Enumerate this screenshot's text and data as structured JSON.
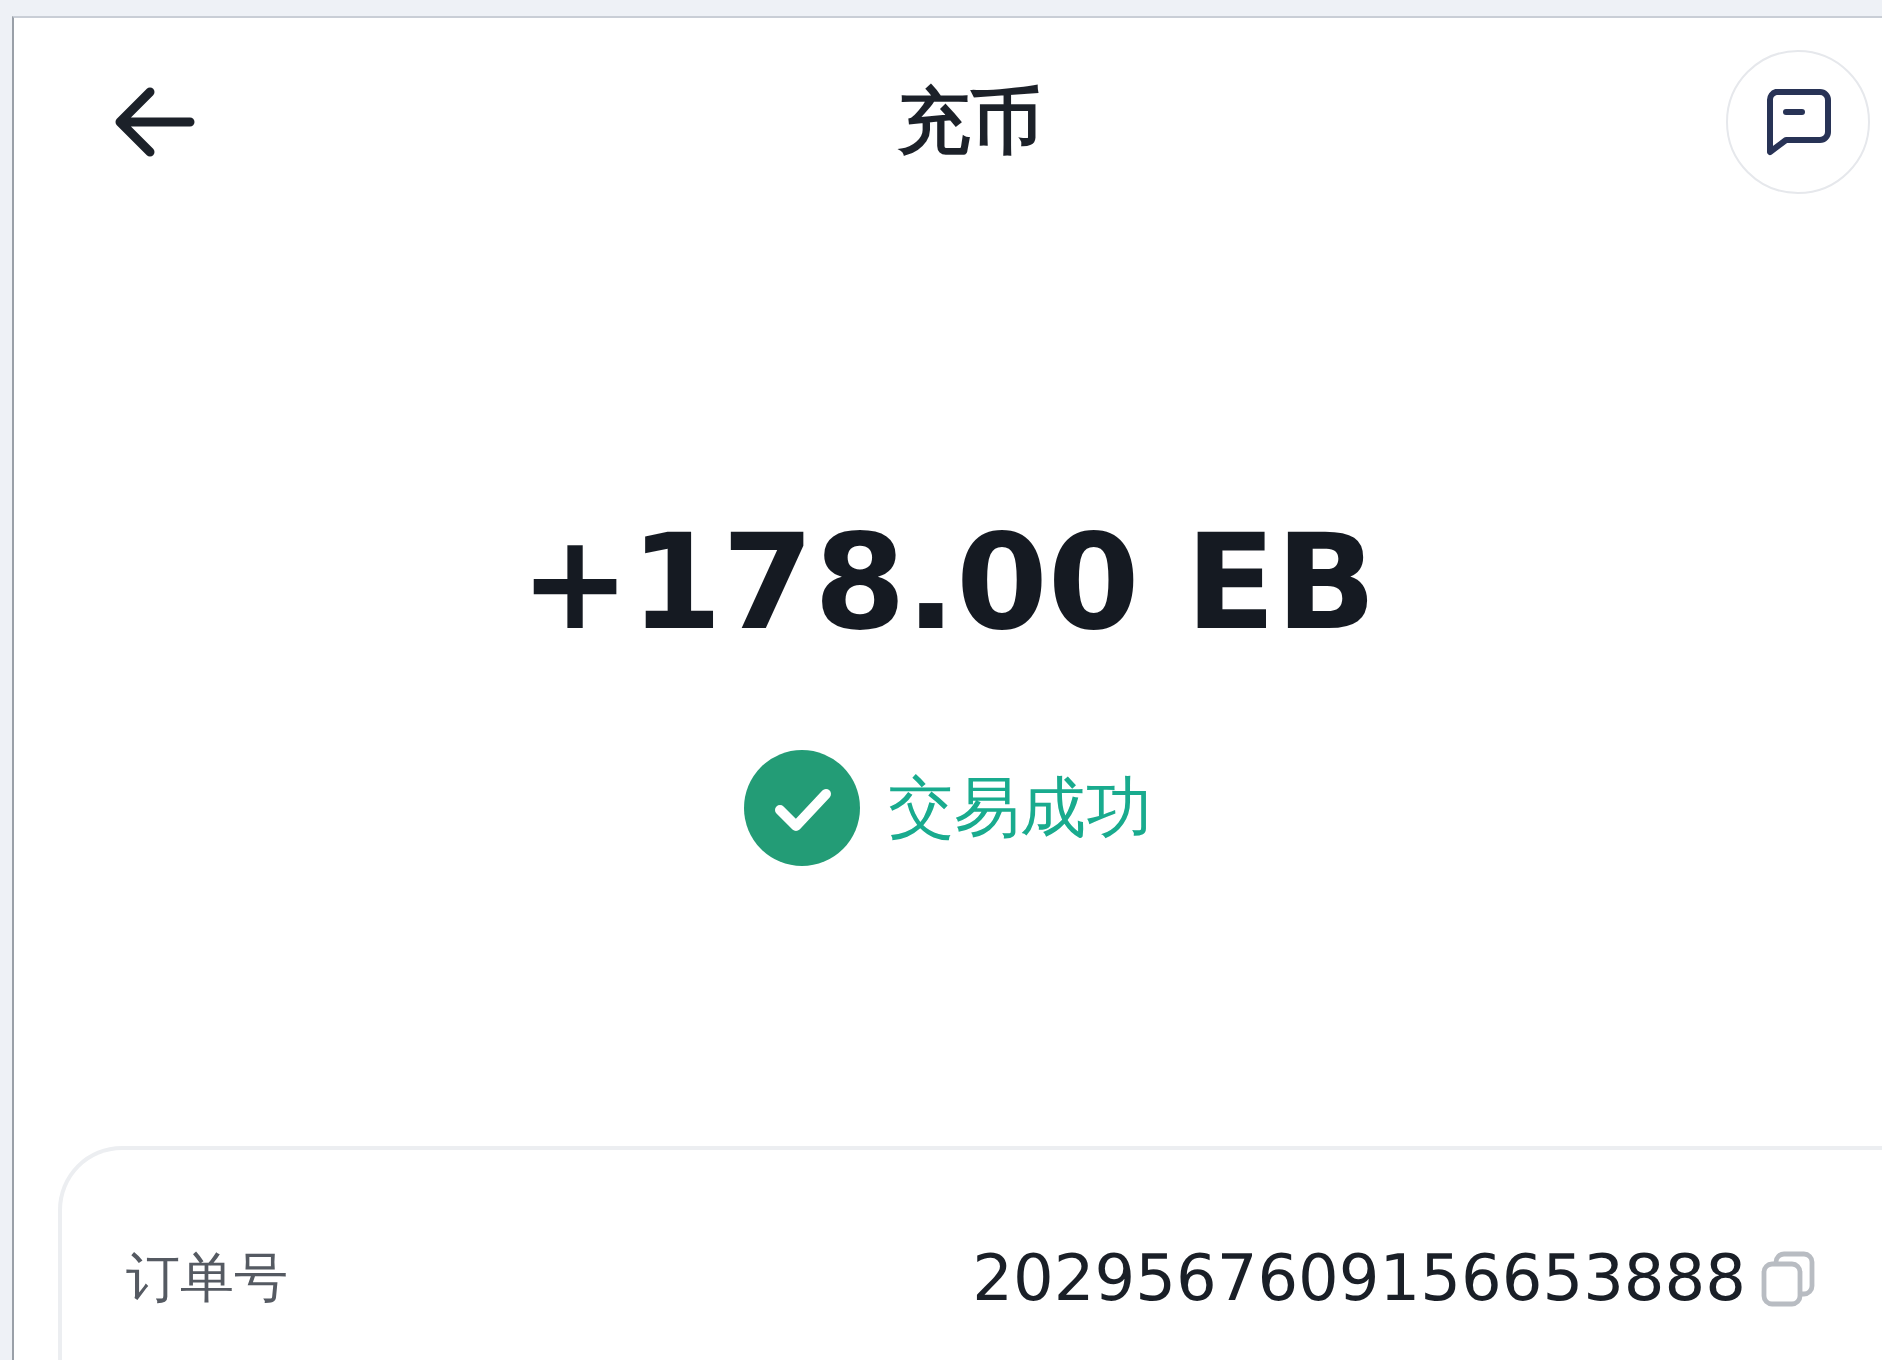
{
  "header": {
    "title": "充币"
  },
  "transaction": {
    "amount": "+178.00 EB",
    "status": {
      "kind": "success",
      "label": "交易成功"
    }
  },
  "details": [
    {
      "label": "订单号",
      "value": "2029567609156653888",
      "copyable": true
    }
  ]
}
